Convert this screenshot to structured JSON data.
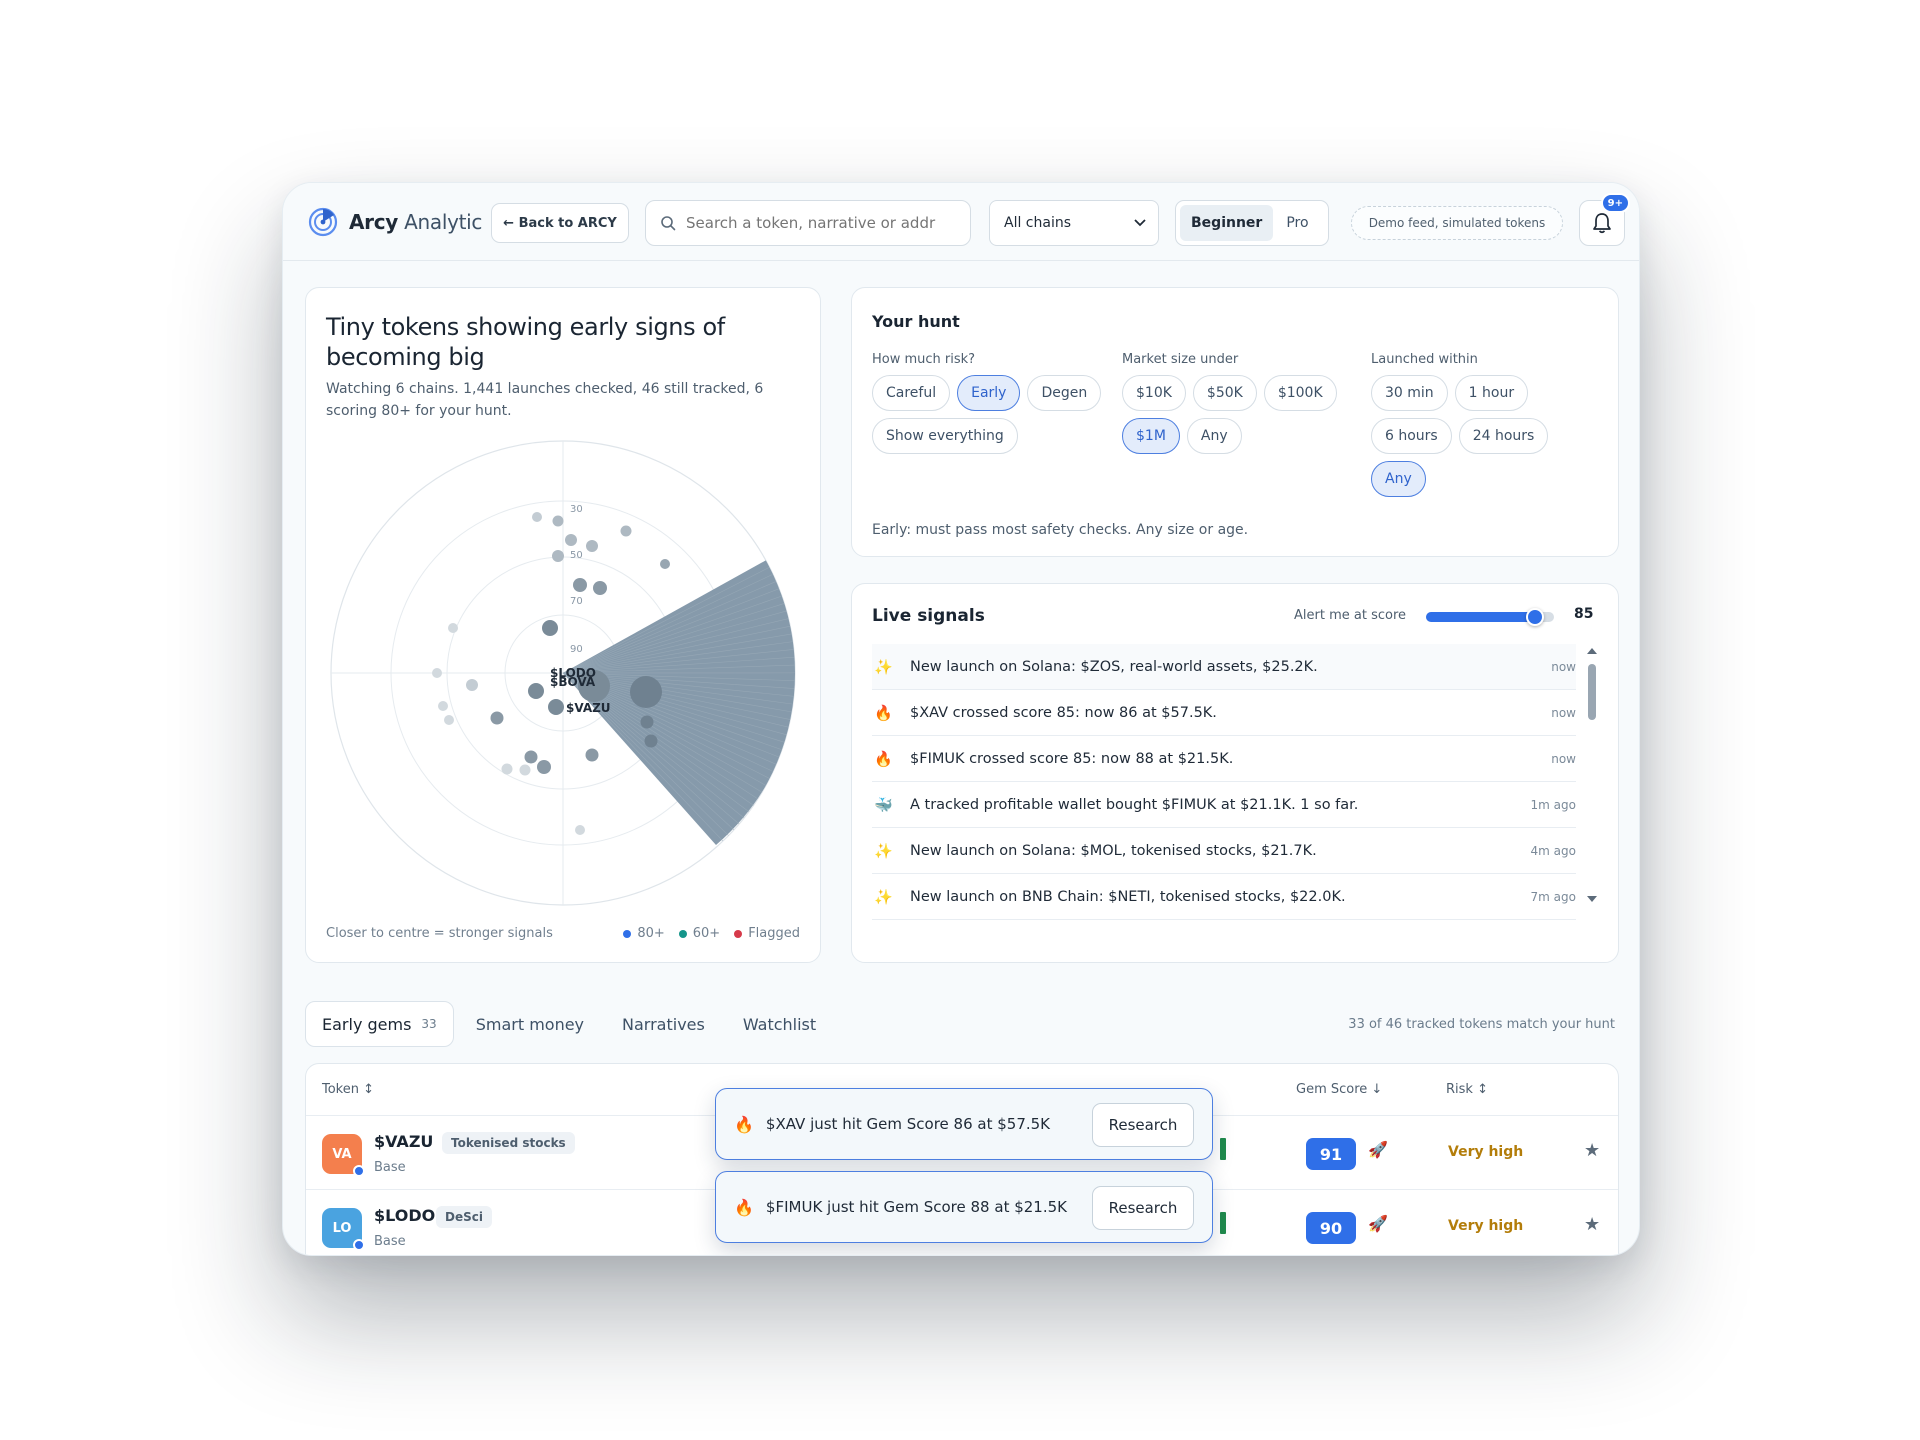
{
  "app": {
    "brand_bold": "Arcy",
    "brand_light": "Analytic",
    "back_label": "← Back to ARCY",
    "search_placeholder": "Search a token, narrative or addr",
    "chain_select": "All chains",
    "mode_options": [
      "Beginner",
      "Pro"
    ],
    "mode_selected": "Beginner",
    "demo_label": "Demo feed, simulated tokens",
    "notif_badge": "9+"
  },
  "radar": {
    "title": "Tiny tokens showing early signs of becoming big",
    "subtitle": "Watching 6 chains. 1,441 launches checked, 46 still tracked, 6 scoring 80+ for your hunt.",
    "ring_labels": [
      "30",
      "50",
      "70",
      "90"
    ],
    "point_labels": [
      "$LODO",
      "$BOVA",
      "$VAZU"
    ],
    "footnote": "Closer to centre = stronger signals",
    "legend": [
      {
        "label": "80+",
        "color": "#2f6fe8"
      },
      {
        "label": "60+",
        "color": "#14958a"
      },
      {
        "label": "Flagged",
        "color": "#d63a4a"
      }
    ]
  },
  "hunt": {
    "title": "Your hunt",
    "risk_label": "How much risk?",
    "risk_options": [
      "Careful",
      "Early",
      "Degen",
      "Show everything"
    ],
    "risk_selected": "Early",
    "size_label": "Market size under",
    "size_options": [
      "$10K",
      "$50K",
      "$100K",
      "$1M",
      "Any"
    ],
    "size_selected": "$1M",
    "launch_label": "Launched within",
    "launch_options": [
      "30 min",
      "1 hour",
      "6 hours",
      "24 hours",
      "Any"
    ],
    "launch_selected": "Any",
    "note": "Early: must pass most safety checks. Any size or age."
  },
  "signals": {
    "title": "Live signals",
    "alert_label": "Alert me at score",
    "alert_value": "85",
    "alert_fraction": 0.85,
    "items": [
      {
        "icon": "sparkle-icon",
        "glyph": "✨",
        "text": "New launch on Solana: $ZOS, real-world assets, $25.2K.",
        "time": "now"
      },
      {
        "icon": "fire-icon",
        "glyph": "🔥",
        "text": "$XAV crossed score 85: now 86 at $57.5K.",
        "time": "now"
      },
      {
        "icon": "fire-icon",
        "glyph": "🔥",
        "text": "$FIMUK crossed score 85: now 88 at $21.5K.",
        "time": "now"
      },
      {
        "icon": "whale-icon",
        "glyph": "🐳",
        "text": "A tracked profitable wallet bought $FIMUK at $21.1K. 1 so far.",
        "time": "1m ago"
      },
      {
        "icon": "sparkle-icon",
        "glyph": "✨",
        "text": "New launch on Solana: $MOL, tokenised stocks, $21.7K.",
        "time": "4m ago"
      },
      {
        "icon": "sparkle-icon",
        "glyph": "✨",
        "text": "New launch on BNB Chain: $NETI, tokenised stocks, $22.0K.",
        "time": "7m ago"
      }
    ]
  },
  "tabs": {
    "items": [
      {
        "label": "Early gems",
        "count": "33"
      },
      {
        "label": "Smart money",
        "count": ""
      },
      {
        "label": "Narratives",
        "count": ""
      },
      {
        "label": "Watchlist",
        "count": ""
      }
    ],
    "match_note": "33 of 46 tracked tokens match your hunt"
  },
  "table": {
    "headers": {
      "token": "Token ↕",
      "score": "Gem Score ↓",
      "risk": "Risk ↕"
    },
    "rows": [
      {
        "initials": "VA",
        "color": "#f47f4d",
        "name": "$VAZU",
        "tag": "Tokenised stocks",
        "chain": "Base",
        "score": "91",
        "risk": "Very high"
      },
      {
        "initials": "LO",
        "color": "#4aa3e0",
        "name": "$LODO",
        "tag": "DeSci",
        "chain": "Base",
        "score": "90",
        "risk": "Very high"
      }
    ]
  },
  "toasts": [
    {
      "text": "$XAV just hit Gem Score 86 at $57.5K",
      "button": "Research"
    },
    {
      "text": "$FIMUK just hit Gem Score 88 at $21.5K",
      "button": "Research"
    }
  ]
}
